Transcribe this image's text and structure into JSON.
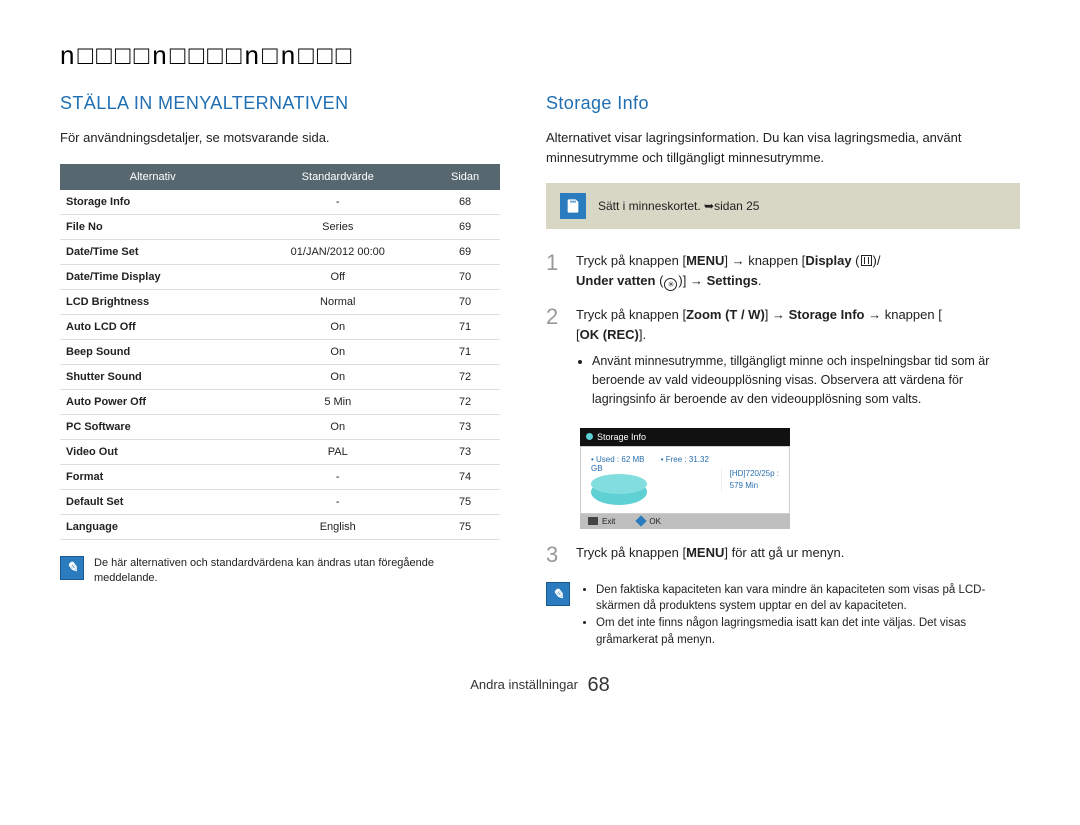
{
  "section_title": "n□□□□n□□□□n□n□□□",
  "left": {
    "heading": "STÄLLA IN MENYALTERNATIVEN",
    "intro": "För användningsdetaljer, se motsvarande sida.",
    "table_headers": {
      "opt": "Alternativ",
      "def": "Standardvärde",
      "pg": "Sidan"
    },
    "rows": [
      {
        "opt": "Storage Info",
        "def": "-",
        "pg": "68"
      },
      {
        "opt": "File No",
        "def": "Series",
        "pg": "69"
      },
      {
        "opt": "Date/Time Set",
        "def": "01/JAN/2012 00:00",
        "pg": "69"
      },
      {
        "opt": "Date/Time Display",
        "def": "Off",
        "pg": "70"
      },
      {
        "opt": "LCD Brightness",
        "def": "Normal",
        "pg": "70"
      },
      {
        "opt": "Auto LCD Off",
        "def": "On",
        "pg": "71"
      },
      {
        "opt": "Beep Sound",
        "def": "On",
        "pg": "71"
      },
      {
        "opt": "Shutter Sound",
        "def": "On",
        "pg": "72"
      },
      {
        "opt": "Auto Power Off",
        "def": "5 Min",
        "pg": "72"
      },
      {
        "opt": "PC Software",
        "def": "On",
        "pg": "73"
      },
      {
        "opt": "Video Out",
        "def": "PAL",
        "pg": "73"
      },
      {
        "opt": "Format",
        "def": "-",
        "pg": "74"
      },
      {
        "opt": "Default Set",
        "def": "-",
        "pg": "75"
      },
      {
        "opt": "Language",
        "def": "English",
        "pg": "75"
      }
    ],
    "note": "De här alternativen och standardvärdena kan ändras utan föregående meddelande."
  },
  "right": {
    "heading": "Storage Info",
    "intro": "Alternativet visar lagringsinformation. Du kan visa lagringsmedia, använt minnesutrymme och tillgängligt minnesutrymme.",
    "tip": "Sätt i minneskortet. ➥sidan 25",
    "step1_a": "Tryck på knappen [",
    "menu": "MENU",
    "step1_b": "] → knappen [",
    "display": "Display",
    "under": "Under vatten",
    "settings": "Settings",
    "step2_a": "Tryck på knappen [",
    "zoom": "Zoom (T / W)",
    "storage": "Storage Info",
    "step2_b": " → knappen [",
    "okrec": "OK (REC)",
    "step2_c": "].",
    "step2_bullet": "Använt minnesutrymme, tillgängligt minne och inspelningsbar tid som är beroende av vald videoupplösning visas. Observera att värdena för lagringsinfo är beroende av den videoupplösning som valts.",
    "screen": {
      "title": "Storage Info",
      "used": "• Used : 62 MB",
      "free": "• Free : 31.32 GB",
      "res": "[HD]720/25p :",
      "time": "579 Min",
      "exit": "Exit",
      "ok": "OK"
    },
    "step3_a": "Tryck på knappen [",
    "step3_b": "] för att gå ur menyn.",
    "notes_b1": "Den faktiska kapaciteten kan vara mindre än kapaciteten som visas på LCD-skärmen då produktens system upptar en del av kapaciteten.",
    "notes_b2": "Om det inte finns någon lagringsmedia isatt kan det inte väljas. Det visas gråmarkerat på menyn."
  },
  "footer": {
    "label": "Andra inställningar",
    "page": "68"
  }
}
